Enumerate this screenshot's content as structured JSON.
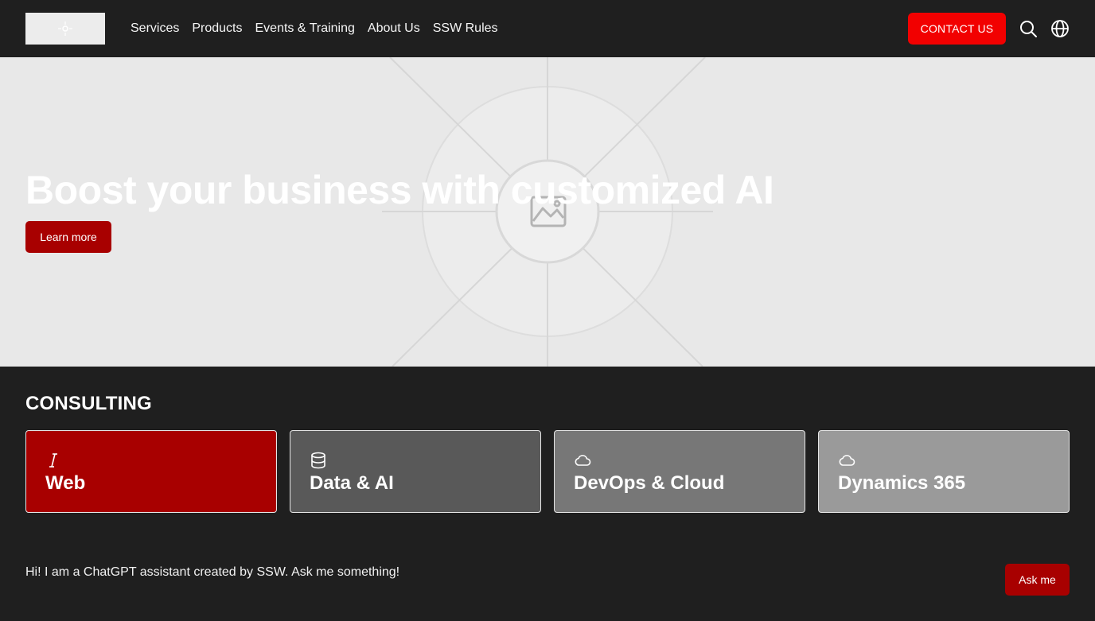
{
  "header": {
    "nav": [
      "Services",
      "Products",
      "Events & Training",
      "About Us",
      "SSW Rules"
    ],
    "contact_label": "CONTACT US",
    "icons": {
      "logo": "logo-placeholder-icon",
      "search": "search-icon",
      "language": "globe-icon"
    }
  },
  "hero": {
    "title": "Boost your business with customized AI",
    "cta_label": "Learn more",
    "image_icon": "image-placeholder-icon"
  },
  "consulting": {
    "title": "CONSULTING",
    "cards": [
      {
        "label": "Web",
        "icon": "cursor-icon",
        "color": "#a80000"
      },
      {
        "label": "Data & AI",
        "icon": "database-icon",
        "color": "#595959"
      },
      {
        "label": "DevOps & Cloud",
        "icon": "cloud-icon",
        "color": "#777777"
      },
      {
        "label": "Dynamics 365",
        "icon": "cloud-icon",
        "color": "#9a9a9a"
      }
    ]
  },
  "chat": {
    "text": "Hi! I am a ChatGPT assistant created by SSW. Ask me something!",
    "button_label": "Ask me"
  },
  "colors": {
    "brand_red": "#f20000",
    "dark_red": "#a80000",
    "dark_bg": "#1f1f1f"
  }
}
